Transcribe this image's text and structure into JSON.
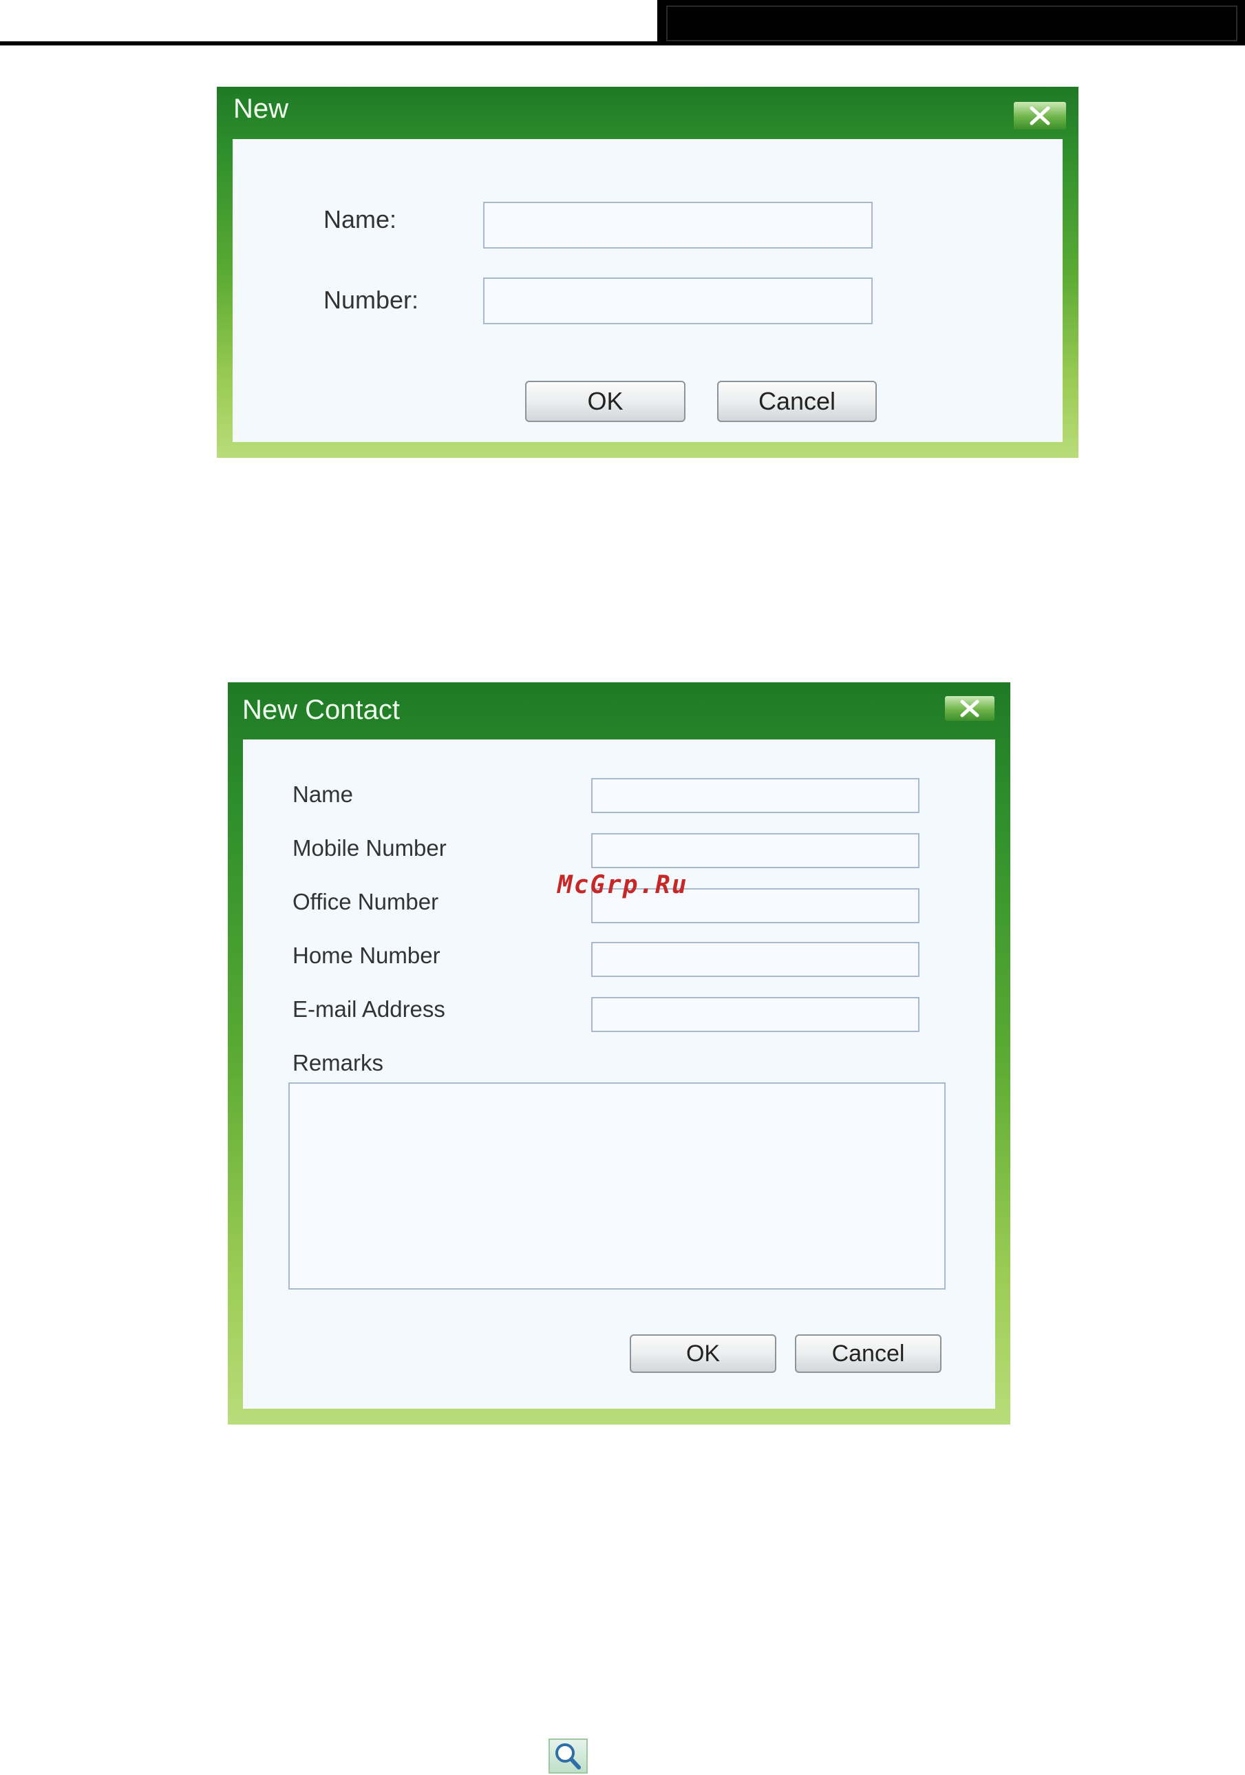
{
  "dialog_new": {
    "title": "New",
    "name_label": "Name:",
    "number_label": "Number:",
    "name_value": "",
    "number_value": "",
    "ok_label": "OK",
    "cancel_label": "Cancel"
  },
  "dialog_contact": {
    "title": "New Contact",
    "fields": [
      {
        "label": "Name",
        "value": ""
      },
      {
        "label": "Mobile Number",
        "value": ""
      },
      {
        "label": "Office Number",
        "value": ""
      },
      {
        "label": "Home Number",
        "value": ""
      },
      {
        "label": "E-mail Address",
        "value": ""
      }
    ],
    "remarks_label": "Remarks",
    "remarks_value": "",
    "ok_label": "OK",
    "cancel_label": "Cancel"
  },
  "watermark": "McGrp.Ru",
  "icons": {
    "close": "close-icon",
    "search": "search-icon"
  },
  "colors": {
    "title_bar_green": "#1f7a26",
    "frame_light_green": "#b8dc7a",
    "body_background": "#f4f9fe"
  }
}
